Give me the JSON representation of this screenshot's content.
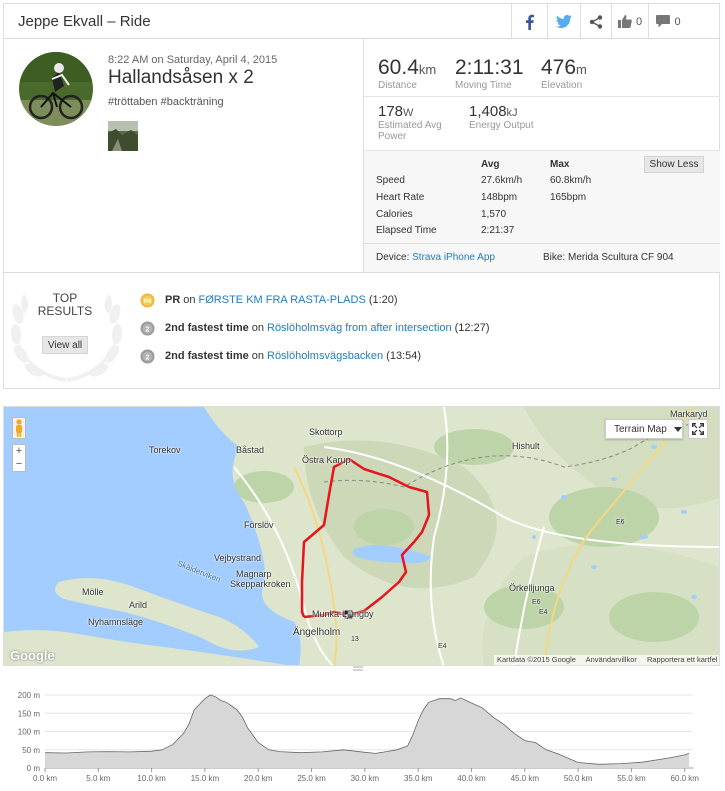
{
  "header": {
    "title": "Jeppe Ekvall – Ride",
    "kudos_count": "0",
    "comments_count": "0"
  },
  "activity": {
    "date": "8:22 AM on Saturday, April 4, 2015",
    "name": "Hallandsåsen x 2",
    "description": "#tröttaben #backträning"
  },
  "stats": {
    "distance": {
      "value": "60.4",
      "unit": "km",
      "label": "Distance"
    },
    "moving_time": {
      "value": "2:11:31",
      "label": "Moving Time"
    },
    "elevation": {
      "value": "476",
      "unit": "m",
      "label": "Elevation"
    },
    "power": {
      "value": "178",
      "unit": "W",
      "label_1": "Estimated Avg",
      "label_2": "Power"
    },
    "energy": {
      "value": "1,408",
      "unit": "kJ",
      "label": "Energy Output"
    }
  },
  "details": {
    "col_avg": "Avg",
    "col_max": "Max",
    "show_less": "Show Less",
    "rows": [
      {
        "label": "Speed",
        "avg": "27.6km/h",
        "max": "60.8km/h"
      },
      {
        "label": "Heart Rate",
        "avg": "148bpm",
        "max": "165bpm"
      },
      {
        "label": "Calories",
        "avg": "1,570",
        "max": ""
      },
      {
        "label": "Elapsed Time",
        "avg": "2:21:37",
        "max": ""
      }
    ],
    "device_label": "Device:",
    "device": "Strava iPhone App",
    "bike_label": "Bike:",
    "bike": "Merida Scultura CF 904"
  },
  "top_results": {
    "title_1": "TOP",
    "title_2": "RESULTS",
    "view_all": "View all",
    "items": [
      {
        "medal": "PR",
        "rank": "PR",
        "on": "on",
        "segment": "FØRSTE KM FRA RASTA-PLADS",
        "time": "(1:20)"
      },
      {
        "medal": "2",
        "rank": "2nd fastest time",
        "on": "on",
        "segment": "Röslöholmsväg from after intersection",
        "time": "(12:27)"
      },
      {
        "medal": "2",
        "rank": "2nd fastest time",
        "on": "on",
        "segment": "Röslöholmsvägsbacken",
        "time": "(13:54)"
      }
    ]
  },
  "map": {
    "type_button": "Terrain Map",
    "zoom_in": "+",
    "zoom_out": "−",
    "logo": "Google",
    "attribution_data": "Kartdata ©2015 Google",
    "attribution_terms": "Användarvillkor",
    "attribution_report": "Rapportera ett kartfel",
    "labels": {
      "skottorp": "Skottorp",
      "bastad": "Båstad",
      "torekov": "Torekov",
      "ostra_karup": "Östra Karup",
      "hishult": "Hishult",
      "markaryd": "Markaryd",
      "forslov": "Förslöv",
      "vejbystrand": "Vejbystrand",
      "magnarp": "Magnarp",
      "skepparkroken": "Skepparkroken",
      "skalderviken": "Skäldervi­ken",
      "molle": "Mölle",
      "arild": "Arild",
      "nyhamnslage": "Nyhamnsläge",
      "angelholm": "Ängelholm",
      "munka": "Munka-Ljungby",
      "orkelljunga": "Örkelljunga",
      "e6a": "E6",
      "e6b": "E6",
      "e4a": "E4",
      "e4b": "E4",
      "r13": "13"
    },
    "colors": {
      "route": "#e8141d",
      "water": "#a3ccff",
      "land": "#dfe8cf"
    }
  },
  "elevation": {
    "y_ticks": [
      "0 m",
      "50 m",
      "100 m",
      "150 m",
      "200 m"
    ],
    "x_ticks": [
      "0.0 km",
      "5.0 km",
      "10.0 km",
      "15.0 km",
      "20.0 km",
      "25.0 km",
      "30.0 km",
      "35.0 km",
      "40.0 km",
      "45.0 km",
      "50.0 km",
      "55.0 km",
      "60.0 km"
    ]
  },
  "chart_data": {
    "type": "area",
    "xlabel": "",
    "ylabel": "",
    "xlim": [
      0,
      60.4
    ],
    "ylim": [
      0,
      200
    ],
    "x": [
      0,
      2,
      4,
      6,
      8,
      10,
      11,
      12,
      13,
      13.5,
      14,
      14.5,
      15,
      15.5,
      16,
      16.5,
      17,
      17.5,
      18,
      18.5,
      19,
      20,
      21,
      22,
      24,
      26,
      28,
      30,
      31,
      32,
      33,
      34,
      34.5,
      35,
      35.5,
      36,
      37,
      38,
      38.5,
      39,
      40,
      41,
      42,
      43,
      44,
      45,
      46,
      47,
      48,
      50,
      52,
      54,
      56,
      58,
      59,
      60,
      60.4
    ],
    "values": [
      42,
      41,
      44,
      45,
      44,
      46,
      50,
      65,
      95,
      120,
      160,
      175,
      190,
      200,
      195,
      185,
      180,
      170,
      160,
      140,
      110,
      70,
      50,
      45,
      42,
      44,
      50,
      43,
      40,
      45,
      50,
      60,
      90,
      130,
      160,
      180,
      190,
      190,
      185,
      192,
      178,
      165,
      140,
      120,
      95,
      75,
      70,
      50,
      40,
      15,
      10,
      12,
      16,
      25,
      30,
      36,
      40
    ],
    "colors": {
      "fill": "#d7d7d7",
      "line": "#666666"
    }
  }
}
